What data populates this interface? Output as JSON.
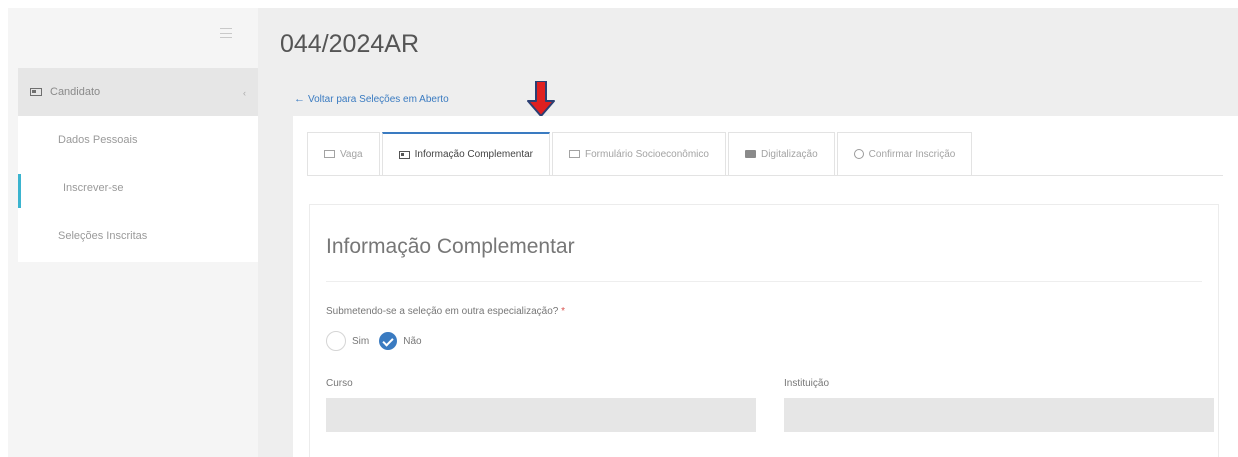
{
  "app": {
    "page_title": "044/2024AR",
    "back_link": "Voltar para Seleções em Aberto"
  },
  "sidebar": {
    "header": {
      "label": "Candidato",
      "icon": "id-card-icon"
    },
    "items": [
      {
        "label": "Dados Pessoais"
      },
      {
        "label": "Inscrever-se",
        "active": true
      },
      {
        "label": "Seleções Inscritas"
      }
    ]
  },
  "tabs": [
    {
      "label": "Vaga",
      "icon": "grid-icon"
    },
    {
      "label": "Informação Complementar",
      "icon": "id-card-icon",
      "active": true
    },
    {
      "label": "Formulário Socioeconômico",
      "icon": "calendar-icon"
    },
    {
      "label": "Digitalização",
      "icon": "folder-icon"
    },
    {
      "label": "Confirmar Inscrição",
      "icon": "check-circle-icon"
    }
  ],
  "form": {
    "title": "Informação Complementar",
    "question": "Submetendo-se a seleção em outra especialização?",
    "required_mark": "*",
    "options": [
      {
        "label": "Sim",
        "checked": false
      },
      {
        "label": "Não",
        "checked": true
      }
    ],
    "fields": {
      "curso": {
        "label": "Curso",
        "value": ""
      },
      "instituicao": {
        "label": "Instituição",
        "value": ""
      }
    }
  },
  "colors": {
    "accent": "#3a7bc1",
    "active_indicator": "#3bb4cf",
    "annotation_arrow": "#e02020"
  }
}
